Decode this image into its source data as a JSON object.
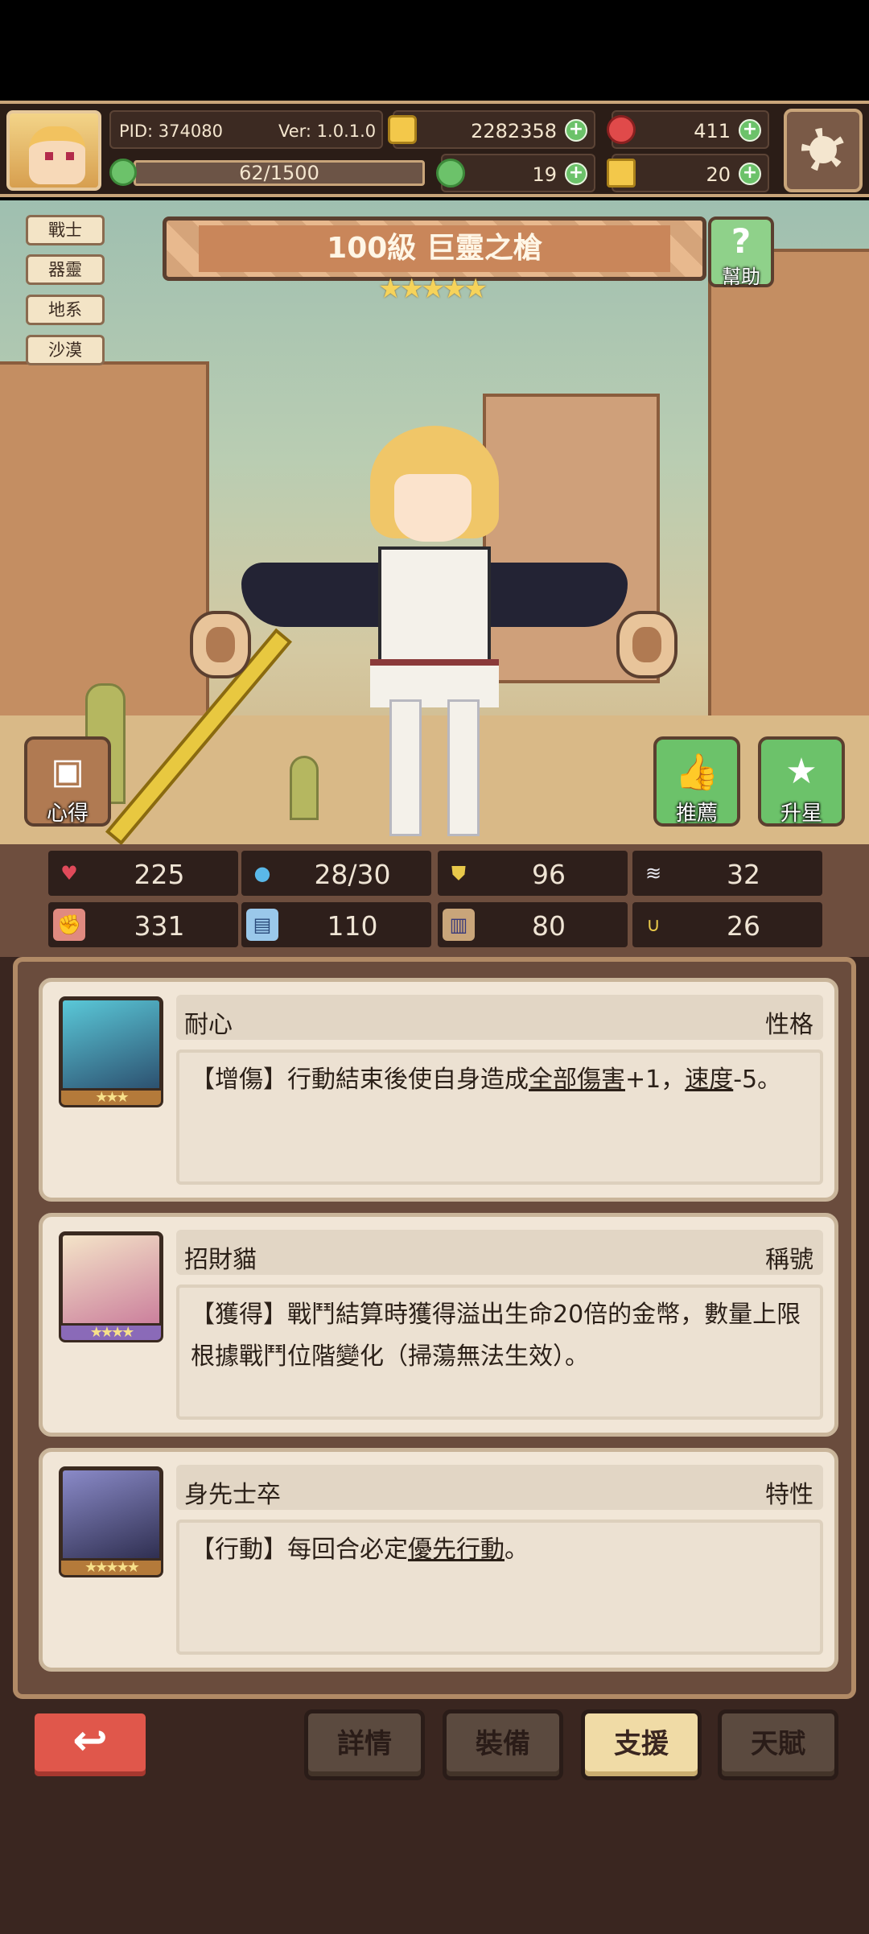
{
  "header": {
    "pid": "PID: 374080",
    "version": "Ver: 1.0.1.0",
    "xp": "62/1500",
    "gold": "2282358",
    "gems": "411",
    "clover": "19",
    "keys": "20",
    "plus": "+"
  },
  "hero": {
    "tags": [
      "戰士",
      "器靈",
      "地系",
      "沙漠"
    ],
    "title": "100級  巨靈之槍",
    "stars": "★★★★★",
    "help_label": "幫助",
    "help_glyph": "?",
    "guide_label": "心得",
    "recommend_label": "推薦",
    "upgrade_label": "升星"
  },
  "stats": [
    {
      "icon": "heart-icon",
      "value": "225"
    },
    {
      "icon": "water-drop-icon",
      "value": "28/30"
    },
    {
      "icon": "shield-icon",
      "value": "96"
    },
    {
      "icon": "wing-icon",
      "value": "32"
    },
    {
      "icon": "fist-icon",
      "value": "331"
    },
    {
      "icon": "book-icon",
      "value": "110"
    },
    {
      "icon": "scroll-icon",
      "value": "80"
    },
    {
      "icon": "horseshoe-icon",
      "value": "26"
    }
  ],
  "cards": [
    {
      "name": "耐心",
      "type": "性格",
      "stars": "★★★",
      "desc_pre": "【增傷】行動結束後使自身造成",
      "desc_u1": "全部傷害",
      "desc_mid": "+1，",
      "desc_u2": "速度",
      "desc_post": "-5。"
    },
    {
      "name": "招財貓",
      "type": "稱號",
      "stars": "★★★★",
      "desc": "【獲得】戰鬥結算時獲得溢出生命20倍的金幣，數量上限根據戰鬥位階變化（掃蕩無法生效）。"
    },
    {
      "name": "身先士卒",
      "type": "特性",
      "stars": "★★★★★",
      "desc_pre": "【行動】每回合必定",
      "desc_u1": "優先行動",
      "desc_post": "。"
    }
  ],
  "nav": {
    "back_glyph": "↩",
    "details": "詳情",
    "equipment": "裝備",
    "support": "支援",
    "talent": "天賦"
  },
  "colors": {
    "accent": "#c9a57a",
    "active_tab": "#f0dba6",
    "back_button": "#e0574b",
    "plus_green": "#6cc26a"
  }
}
